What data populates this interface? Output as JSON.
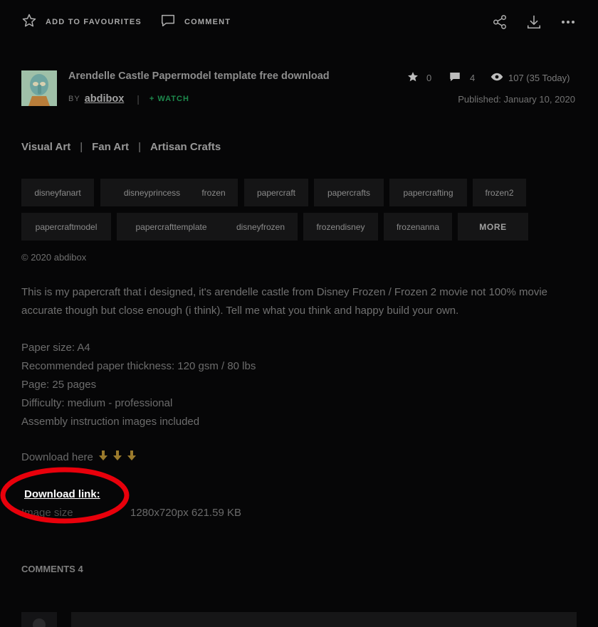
{
  "toolbar": {
    "favourite_label": "ADD TO FAVOURITES",
    "comment_label": "COMMENT",
    "icons": [
      "star-outline-icon",
      "comment-icon",
      "share-icon",
      "download-icon",
      "more-icon"
    ]
  },
  "deviation": {
    "title": "Arendelle Castle Papermodel template free download",
    "by_label": "BY",
    "author": "abdibox",
    "separator": "|",
    "watch_label": "+ WATCH",
    "favourites_count": "0",
    "comments_count": "4",
    "views": "107 (35 Today)",
    "published": "Published: January 10, 2020"
  },
  "categories": [
    "Visual Art",
    "Fan Art",
    "Artisan Crafts"
  ],
  "category_separator": "|",
  "tags": [
    "disneyfanart",
    "disneyprincess",
    "frozen",
    "papercraft",
    "papercrafts",
    "papercrafting",
    "frozen2",
    "papercraftmodel",
    "papercrafttemplate",
    "disneyfrozen",
    "frozendisney",
    "frozenanna"
  ],
  "more_label": "MORE",
  "copyright": "© 2020 abdibox",
  "description": "This is my papercraft that i designed, it's arendelle castle from Disney Frozen / Frozen 2 movie not 100% movie accurate though but close enough (i think). Tell me what you think and happy build your own.",
  "specs": [
    "Paper size: A4",
    "Recommended paper thickness: 120 gsm / 80 lbs",
    "Page: 25 pages",
    "Difficulty: medium - professional",
    "Assembly instruction images included"
  ],
  "download_here": "Download here",
  "download_link_label": "Download link:",
  "image_size_label": "Image size",
  "image_size_value": "1280x720px 621.59 KB",
  "comments_label": "COMMENTS",
  "comments_total": "4",
  "colors": {
    "background": "#060607",
    "watch": "#1d8a4d",
    "arrow": "#9a7a2c",
    "highlight_ring": "#e8000b"
  }
}
